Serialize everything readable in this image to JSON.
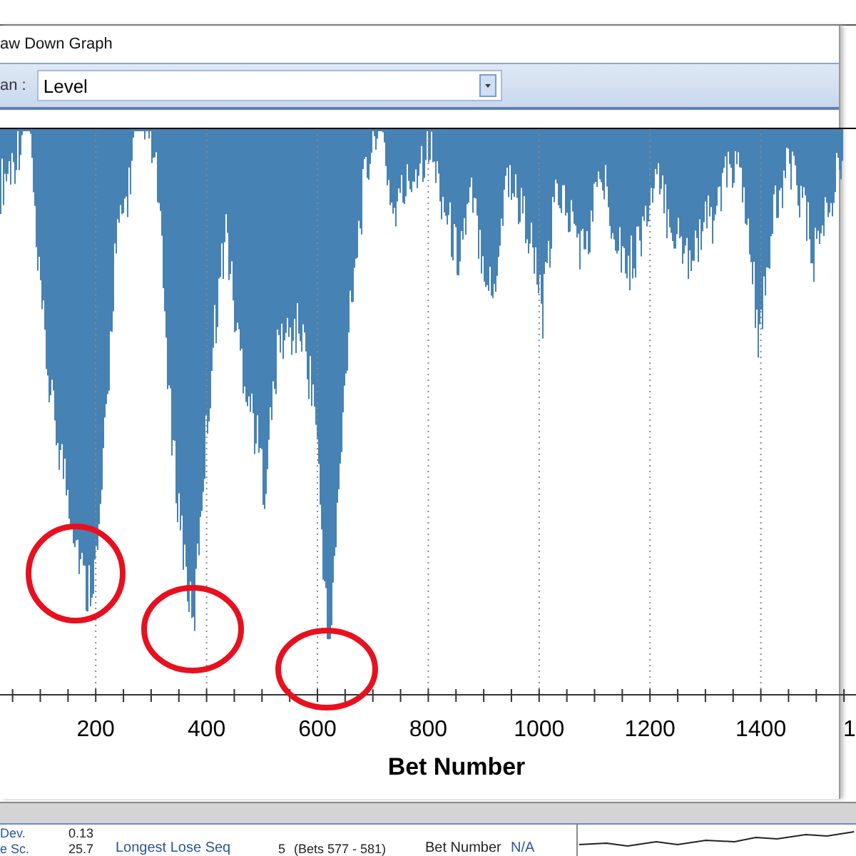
{
  "window": {
    "title": "aw Down Graph"
  },
  "toolbar": {
    "label": "an :",
    "dropdown_value": "Level"
  },
  "graph": {
    "x_tick_labels": [
      "200",
      "400",
      "600",
      "800",
      "1000",
      "1200",
      "1400",
      "1"
    ],
    "x_axis_title": "Bet Number"
  },
  "stats": {
    "rows": [
      {
        "label": "Dev.",
        "value": "0.13"
      },
      {
        "label": "e Sc.",
        "value": "25.7",
        "seq_label": "Longest Lose Seq",
        "seq_count": "5",
        "seq_range": "(Bets 577 - 581)",
        "field_label": "Bet Number",
        "field_value": "N/A"
      }
    ]
  }
}
